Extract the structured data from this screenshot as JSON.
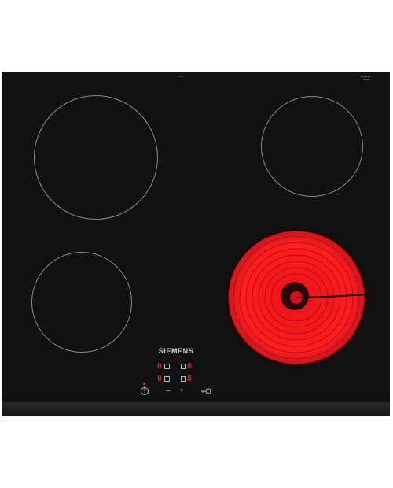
{
  "product": {
    "brand": "SIEMENS",
    "serial_label": "ET6...",
    "badge_text": "SOVIET 5 YEAR",
    "badge_sub": "..."
  },
  "zones": [
    {
      "name": "front-left",
      "level": "0",
      "active": false
    },
    {
      "name": "rear-left",
      "level": "0",
      "active": false
    },
    {
      "name": "front-right",
      "level": "0",
      "active": false
    },
    {
      "name": "rear-right",
      "level": "8",
      "active": true
    }
  ],
  "controls": {
    "power_icon": "power-icon",
    "minus_label": "−",
    "plus_label": "+",
    "lock_icon": "key-lock-icon"
  },
  "colors": {
    "glass": "#111111",
    "heat": "#ff2a14",
    "ring": "#8a8a8a"
  }
}
